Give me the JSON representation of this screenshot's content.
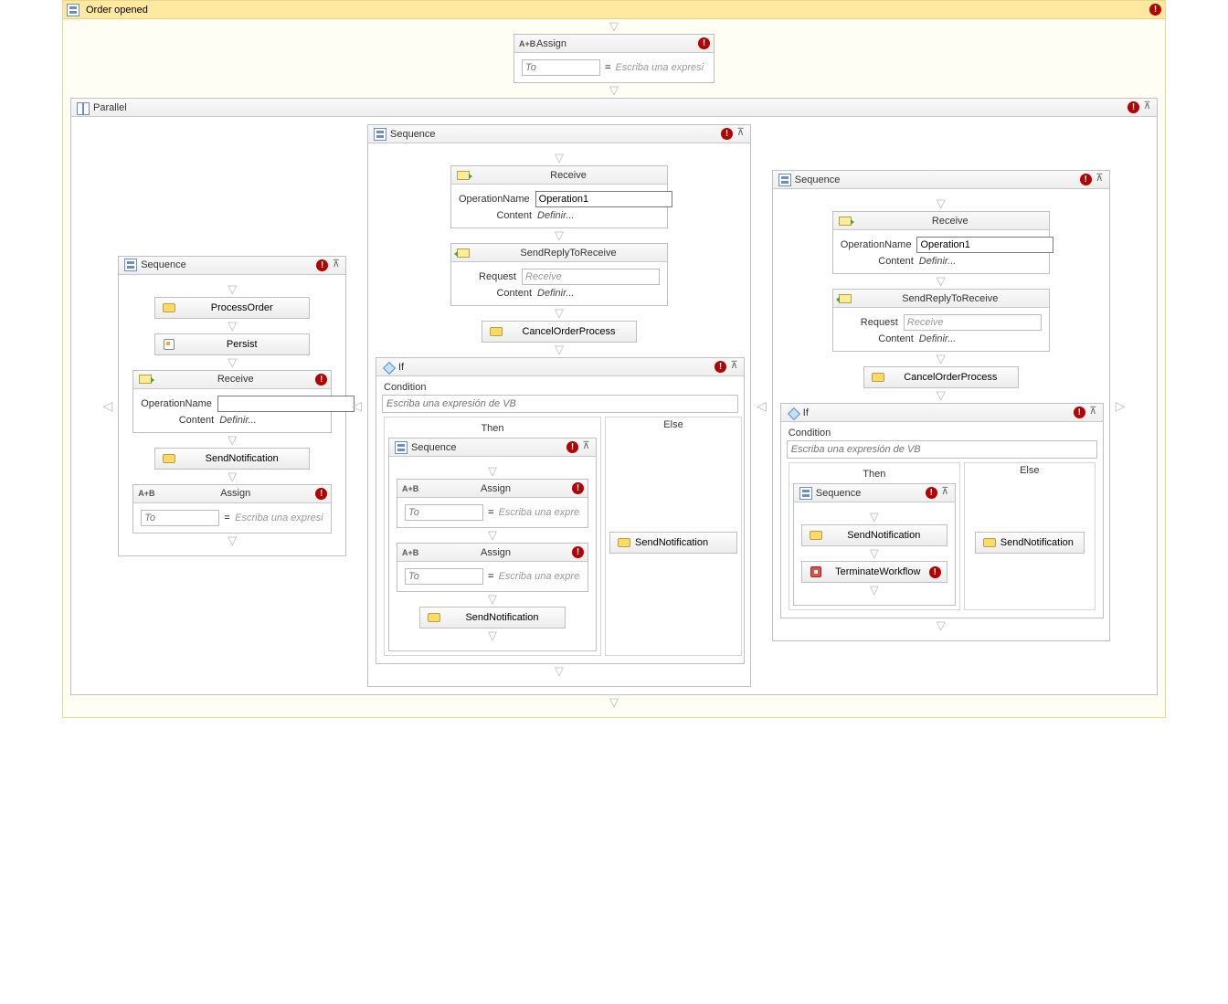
{
  "root": {
    "title": "Order opened"
  },
  "assignTop": {
    "title": "Assign",
    "to_ph": "To",
    "expr_ph": "Escriba una expresi"
  },
  "parallel": {
    "title": "Parallel"
  },
  "seqLeft": {
    "title": "Sequence",
    "processOrder": "ProcessOrder",
    "persist": "Persist",
    "receive": {
      "title": "Receive",
      "opLabel": "OperationName",
      "opValue": "",
      "contentLabel": "Content",
      "contentLink": "Definir..."
    },
    "sendNotification": "SendNotification",
    "assign": {
      "title": "Assign",
      "to_ph": "To",
      "expr_ph": "Escriba una expresi"
    }
  },
  "seqMid": {
    "title": "Sequence",
    "receive": {
      "title": "Receive",
      "opLabel": "OperationName",
      "opValue": "Operation1",
      "contentLabel": "Content",
      "contentLink": "Definir..."
    },
    "reply": {
      "title": "SendReplyToReceive",
      "reqLabel": "Request",
      "reqValue": "Receive",
      "contentLabel": "Content",
      "contentLink": "Definir..."
    },
    "cancel": "CancelOrderProcess",
    "ifAct": {
      "title": "If",
      "condLabel": "Condition",
      "cond_ph": "Escriba una expresión de VB",
      "thenLabel": "Then",
      "elseLabel": "Else",
      "thenSeq": {
        "title": "Sequence",
        "assign1": {
          "title": "Assign",
          "to_ph": "To",
          "expr_ph": "Escriba una expresi"
        },
        "assign2": {
          "title": "Assign",
          "to_ph": "To",
          "expr_ph": "Escriba una expresi"
        },
        "sendNotification": "SendNotification"
      },
      "elseAct": "SendNotification"
    }
  },
  "seqRight": {
    "title": "Sequence",
    "receive": {
      "title": "Receive",
      "opLabel": "OperationName",
      "opValue": "Operation1",
      "contentLabel": "Content",
      "contentLink": "Definir..."
    },
    "reply": {
      "title": "SendReplyToReceive",
      "reqLabel": "Request",
      "reqValue": "Receive",
      "contentLabel": "Content",
      "contentLink": "Definir..."
    },
    "cancel": "CancelOrderProcess",
    "ifAct": {
      "title": "If",
      "condLabel": "Condition",
      "cond_ph": "Escriba una expresión de VB",
      "thenLabel": "Then",
      "elseLabel": "Else",
      "thenSeq": {
        "title": "Sequence",
        "sendNotification": "SendNotification",
        "terminate": "TerminateWorkflow"
      },
      "elseAct": "SendNotification"
    }
  }
}
